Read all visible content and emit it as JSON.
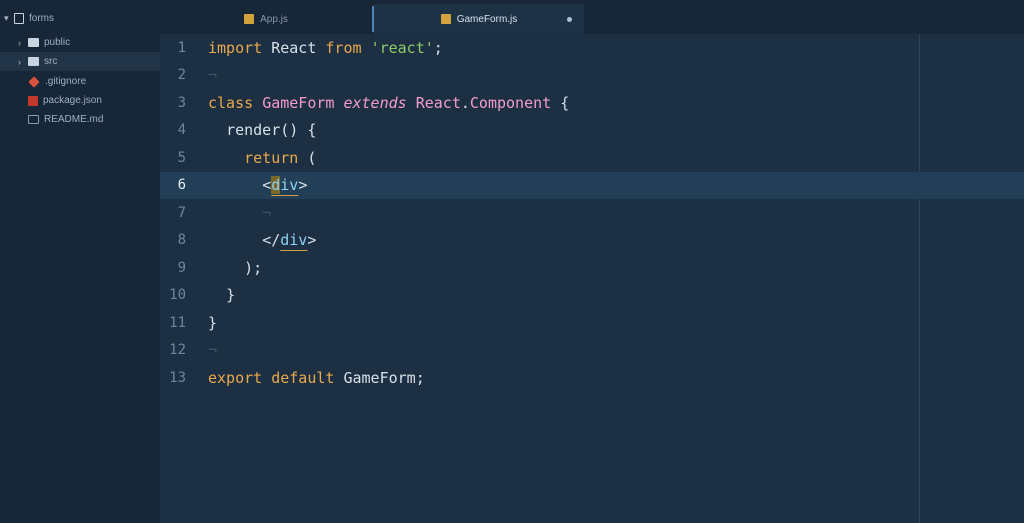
{
  "sidebar": {
    "root": {
      "label": "forms",
      "icon": "repo-icon"
    },
    "items": [
      {
        "label": "public",
        "icon": "folder-icon"
      },
      {
        "label": "src",
        "icon": "folder-icon"
      },
      {
        "label": ".gitignore",
        "icon": "git-icon"
      },
      {
        "label": "package.json",
        "icon": "json-file-icon"
      },
      {
        "label": "README.md",
        "icon": "markdown-file-icon"
      }
    ]
  },
  "tabs": [
    {
      "label": "App.js",
      "icon": "js-file-icon",
      "active": false
    },
    {
      "label": "GameForm.js",
      "icon": "js-file-icon",
      "active": true,
      "modified": true
    }
  ],
  "editor": {
    "current_line": 6,
    "lines": [
      {
        "num": "1",
        "parts": [
          "import",
          "React",
          "from",
          "'react'",
          ";"
        ]
      },
      {
        "num": "2",
        "parts": []
      },
      {
        "num": "3",
        "parts": [
          "class",
          "GameForm",
          "extends",
          "React",
          ".",
          "Component",
          "{"
        ]
      },
      {
        "num": "4",
        "parts": [
          "render",
          "()",
          "{"
        ]
      },
      {
        "num": "5",
        "parts": [
          "return",
          "("
        ]
      },
      {
        "num": "6",
        "parts": [
          "<",
          "d",
          "iv",
          ">"
        ]
      },
      {
        "num": "7",
        "parts": []
      },
      {
        "num": "8",
        "parts": [
          "</",
          "div",
          ">"
        ]
      },
      {
        "num": "9",
        "parts": [
          ");"
        ]
      },
      {
        "num": "10",
        "parts": [
          "}"
        ]
      },
      {
        "num": "11",
        "parts": [
          "}"
        ]
      },
      {
        "num": "12",
        "parts": []
      },
      {
        "num": "13",
        "parts": [
          "export",
          "default",
          "GameForm",
          ";"
        ]
      }
    ]
  },
  "colors": {
    "keyword": "#e8a84c",
    "class_name": "#f29bd1",
    "string": "#8fc96a",
    "tag": "#8fd1f2",
    "background": "#1d3043"
  }
}
